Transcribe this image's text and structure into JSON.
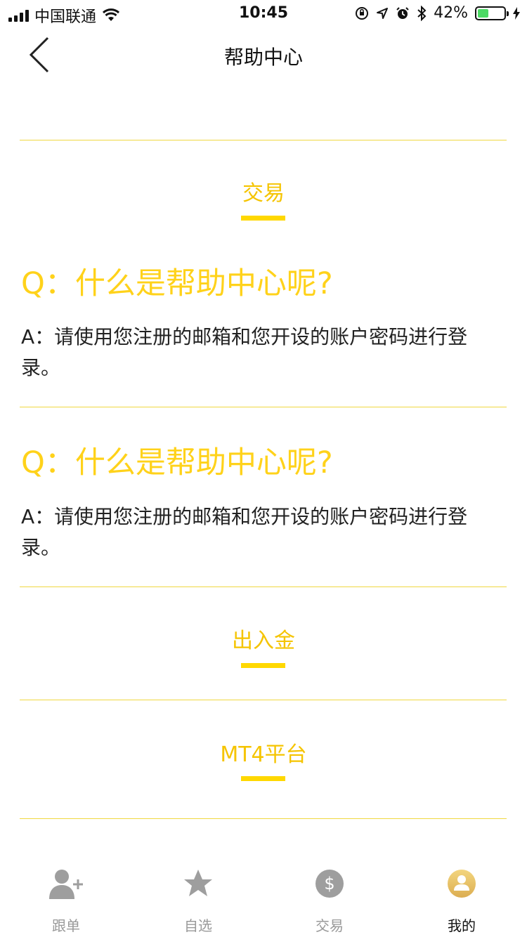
{
  "status_bar": {
    "carrier": "中国联通",
    "time": "10:45",
    "battery_text": "42%",
    "battery_level": 0.42,
    "icons": [
      "signal-icon",
      "wifi-icon",
      "orientation-lock-icon",
      "location-icon",
      "alarm-icon",
      "bluetooth-icon",
      "battery-icon",
      "charging-icon"
    ]
  },
  "nav": {
    "back_icon": "chevron-left-icon",
    "title": "帮助中心"
  },
  "sections": {
    "trade": {
      "label": "交易"
    },
    "faq": [
      {
        "q": "Q：什么是帮助中心呢?",
        "a": "A：请使用您注册的邮箱和您开设的账户密码进行登录。"
      },
      {
        "q": "Q：什么是帮助中心呢?",
        "a": "A：请使用您注册的邮箱和您开设的账户密码进行登录。"
      }
    ],
    "deposit": {
      "label": "出入金"
    },
    "mt4": {
      "label": "MT4平台"
    }
  },
  "tabbar": {
    "items": [
      {
        "label": "跟单",
        "icon": "user-add-icon"
      },
      {
        "label": "自选",
        "icon": "star-icon"
      },
      {
        "label": "交易",
        "icon": "dollar-icon"
      },
      {
        "label": "我的",
        "icon": "profile-icon",
        "active": true
      }
    ]
  },
  "colors": {
    "accent": "#ffd800",
    "question": "#ffd21a",
    "divider": "#f0d840",
    "active_tab": "#e8c25a"
  }
}
